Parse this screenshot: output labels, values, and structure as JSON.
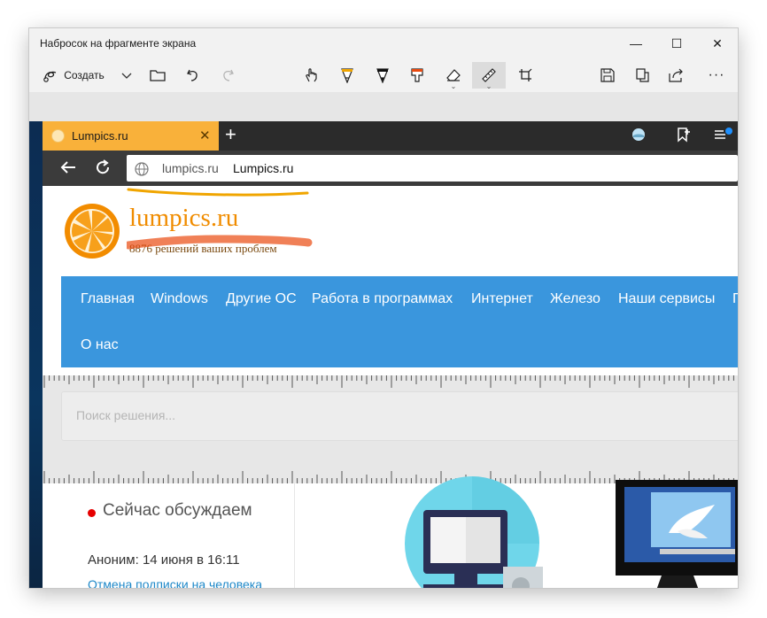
{
  "window": {
    "title": "Набросок на фрагменте экрана",
    "minimize": "—",
    "maximize": "☐",
    "close": "✕"
  },
  "toolbar": {
    "create_label": "Создать",
    "more_label": "···"
  },
  "browser": {
    "tab_title": "Lumpics.ru",
    "tab_close": "✕",
    "new_tab": "+",
    "address_domain": "lumpics.ru",
    "address_title": "Lumpics.ru"
  },
  "site": {
    "name": "lumpics.ru",
    "tagline": "8876 решений ваших проблем",
    "nav": [
      "Главная",
      "Windows",
      "Другие ОС",
      "Работа в программах",
      "Интернет",
      "Железо",
      "Наши сервисы",
      "Г",
      "О нас"
    ],
    "search_placeholder": "Поиск решения...",
    "discuss_title": "Сейчас обсуждаем",
    "comment_author": "Аноним: 14 июня в 16:11",
    "comment_link": "Отмена подписки на человека"
  },
  "colors": {
    "tab_accent": "#f9b13a",
    "nav_blue": "#3a96dd",
    "brand_orange": "#f08c00",
    "annotation_orange": "#f0a500",
    "annotation_red": "#e94a10"
  },
  "icons": [
    "snip-icon",
    "chevron-down-icon",
    "folder-icon",
    "undo-icon",
    "redo-icon",
    "touch-writing-icon",
    "ballpoint-pen-icon",
    "pencil-icon",
    "highlighter-icon",
    "eraser-icon",
    "ruler-icon",
    "crop-icon",
    "save-icon",
    "copy-icon",
    "share-icon"
  ]
}
